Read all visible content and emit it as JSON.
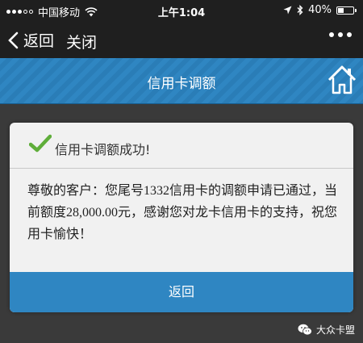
{
  "status_bar": {
    "carrier": "中国移动",
    "time": "上午1:04",
    "battery_percent": "40%",
    "battery_level": 0.4,
    "icons": [
      "signal-dots-icon",
      "wifi-icon",
      "location-arrow-icon",
      "bluetooth-icon",
      "battery-icon"
    ]
  },
  "nav": {
    "back_label": "返回",
    "close_label": "关闭",
    "more_icon": "more-dots-icon"
  },
  "header": {
    "title": "信用卡调额",
    "home_icon": "home-icon",
    "accent_color": "#2f86c2"
  },
  "dialog": {
    "title": "信用卡调额成功!",
    "status_icon": "check-icon",
    "message": "尊敬的客户：您尾号1332信用卡的调额申请已通过，当前额度28,000.00元，感谢您对龙卡信用卡的支持，祝您用卡愉快！",
    "button_label": "返回"
  },
  "watermark": {
    "text": "大众卡盟",
    "icon": "wechat-icon"
  }
}
